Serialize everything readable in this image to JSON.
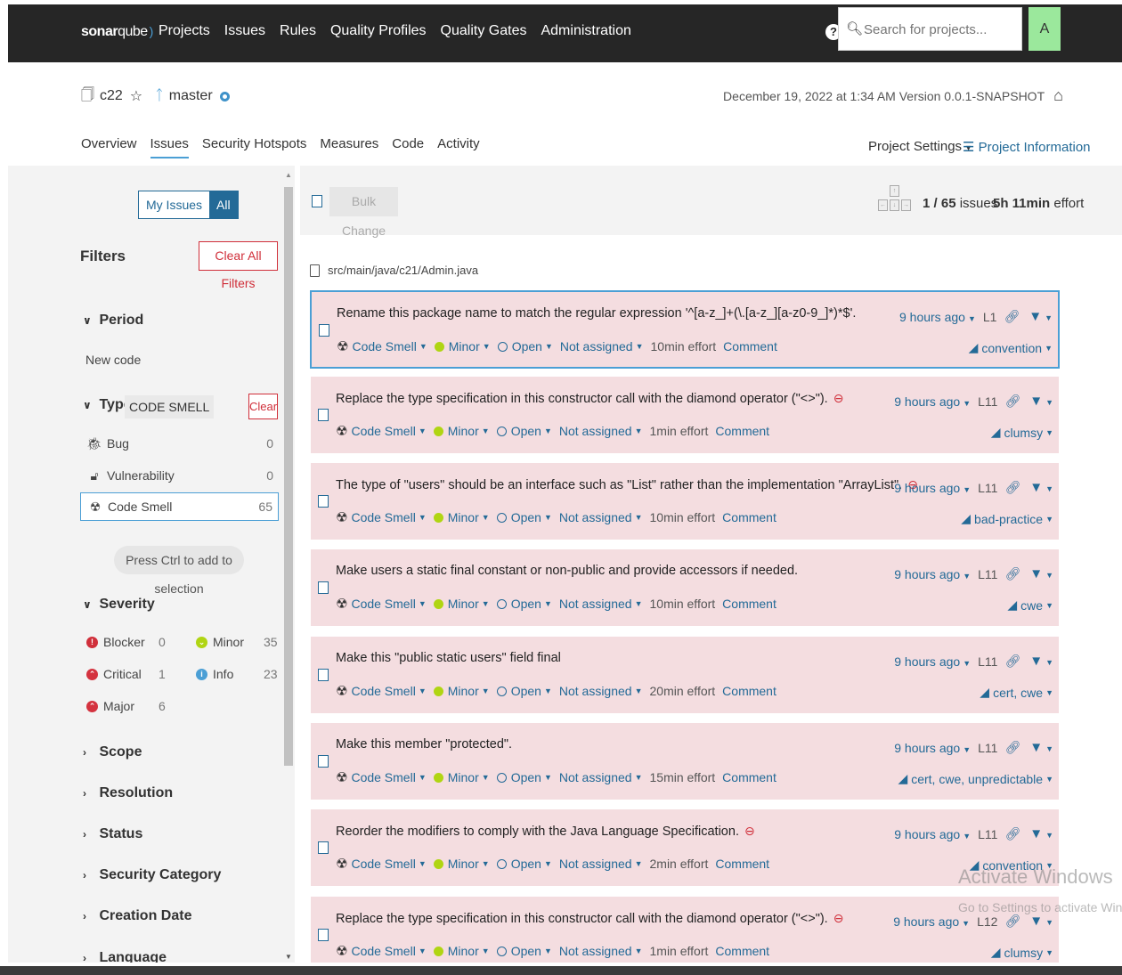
{
  "nav": {
    "logo_bold": "sonar",
    "logo_light": "qube",
    "links": [
      "Projects",
      "Issues",
      "Rules",
      "Quality Profiles",
      "Quality Gates",
      "Administration"
    ],
    "help_icon": "?",
    "search_placeholder": "Search for projects...",
    "avatar_letter": "A"
  },
  "project": {
    "name": "c22",
    "branch": "master",
    "meta": "December 19, 2022 at 1:34 AM  Version 0.0.1-SNAPSHOT",
    "tabs": [
      "Overview",
      "Issues",
      "Security Hotspots",
      "Measures",
      "Code",
      "Activity"
    ],
    "active_tab": "Issues",
    "settings": "Project Settings",
    "information": "Project Information"
  },
  "sidebar": {
    "my_issues": "My Issues",
    "all": "All",
    "filters_title": "Filters",
    "clear_all": "Clear All Filters",
    "period": {
      "label": "Period",
      "option": "New code"
    },
    "type": {
      "label": "Type",
      "selected_tag": "CODE SMELL",
      "clear": "Clear",
      "items": [
        {
          "label": "Bug",
          "count": "0",
          "icon": "bug-icon"
        },
        {
          "label": "Vulnerability",
          "count": "0",
          "icon": "lock-icon"
        },
        {
          "label": "Code Smell",
          "count": "65",
          "icon": "code-smell-icon"
        }
      ]
    },
    "press_ctrl": "Press Ctrl to add to selection",
    "severity": {
      "label": "Severity",
      "items": [
        {
          "label": "Blocker",
          "count": "0",
          "color": "#d02f3a"
        },
        {
          "label": "Minor",
          "count": "35",
          "color": "#b0d513"
        },
        {
          "label": "Critical",
          "count": "1",
          "color": "#d4333f"
        },
        {
          "label": "Info",
          "count": "23",
          "color": "#4b9fd5"
        },
        {
          "label": "Major",
          "count": "6",
          "color": "#d4333f"
        }
      ]
    },
    "collapsed": [
      "Scope",
      "Resolution",
      "Status",
      "Security Category",
      "Creation Date",
      "Language"
    ]
  },
  "main": {
    "bulk_change": "Bulk Change",
    "count_current": "1",
    "count_total": "65",
    "count_suffix": "issues",
    "effort_value": "5h 11min",
    "effort_suffix": "effort",
    "file_path": "src/main/java/c21/Admin.java"
  },
  "issues": [
    {
      "message": "Rename this package name to match the regular expression '^[a-z_]+(\\.[a-z_][a-z0-9_]*)*$'.",
      "has_minus": false,
      "type": "Code Smell",
      "severity": "Minor",
      "status": "Open",
      "assignee": "Not assigned",
      "effort": "10min effort",
      "comment": "Comment",
      "time": "9 hours ago",
      "line": "L1",
      "tags": "convention"
    },
    {
      "message": "Replace the type specification in this constructor call with the diamond operator (\"<>\").",
      "has_minus": true,
      "type": "Code Smell",
      "severity": "Minor",
      "status": "Open",
      "assignee": "Not assigned",
      "effort": "1min effort",
      "comment": "Comment",
      "time": "9 hours ago",
      "line": "L11",
      "tags": "clumsy"
    },
    {
      "message": "The type of \"users\" should be an interface such as \"List\" rather than the implementation \"ArrayList\".",
      "has_minus": true,
      "type": "Code Smell",
      "severity": "Minor",
      "status": "Open",
      "assignee": "Not assigned",
      "effort": "10min effort",
      "comment": "Comment",
      "time": "9 hours ago",
      "line": "L11",
      "tags": "bad-practice"
    },
    {
      "message": "Make users a static final constant or non-public and provide accessors if needed.",
      "has_minus": false,
      "type": "Code Smell",
      "severity": "Minor",
      "status": "Open",
      "assignee": "Not assigned",
      "effort": "10min effort",
      "comment": "Comment",
      "time": "9 hours ago",
      "line": "L11",
      "tags": "cwe"
    },
    {
      "message": "Make this \"public static users\" field final",
      "has_minus": false,
      "type": "Code Smell",
      "severity": "Minor",
      "status": "Open",
      "assignee": "Not assigned",
      "effort": "20min effort",
      "comment": "Comment",
      "time": "9 hours ago",
      "line": "L11",
      "tags": "cert, cwe"
    },
    {
      "message": "Make this member \"protected\".",
      "has_minus": false,
      "type": "Code Smell",
      "severity": "Minor",
      "status": "Open",
      "assignee": "Not assigned",
      "effort": "15min effort",
      "comment": "Comment",
      "time": "9 hours ago",
      "line": "L11",
      "tags": "cert, cwe, unpredictable"
    },
    {
      "message": "Reorder the modifiers to comply with the Java Language Specification.",
      "has_minus": true,
      "type": "Code Smell",
      "severity": "Minor",
      "status": "Open",
      "assignee": "Not assigned",
      "effort": "2min effort",
      "comment": "Comment",
      "time": "9 hours ago",
      "line": "L11",
      "tags": "convention"
    },
    {
      "message": "Replace the type specification in this constructor call with the diamond operator (\"<>\").",
      "has_minus": true,
      "type": "Code Smell",
      "severity": "Minor",
      "status": "Open",
      "assignee": "Not assigned",
      "effort": "1min effort",
      "comment": "Comment",
      "time": "9 hours ago",
      "line": "L12",
      "tags": "clumsy"
    }
  ],
  "watermark": {
    "title": "Activate Windows",
    "subtitle": "Go to Settings to activate Windows."
  }
}
